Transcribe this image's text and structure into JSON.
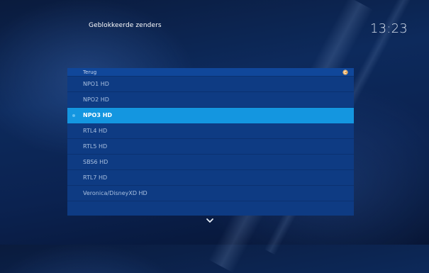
{
  "header": {
    "title": "Geblokkeerde zenders",
    "time": "13:23"
  },
  "list": {
    "back_label": "Terug",
    "items": [
      {
        "label": "NPO1 HD",
        "selected": false
      },
      {
        "label": "NPO2 HD",
        "selected": false
      },
      {
        "label": "NPO3 HD",
        "selected": true
      },
      {
        "label": "RTL4 HD",
        "selected": false
      },
      {
        "label": "RTL5 HD",
        "selected": false
      },
      {
        "label": "SBS6 HD",
        "selected": false
      },
      {
        "label": "RTL7 HD",
        "selected": false
      },
      {
        "label": "Veronica/DisneyXD HD",
        "selected": false
      }
    ]
  },
  "colors": {
    "background": "#0b2250",
    "list_background": "#0e3b83",
    "selected": "#1496e0",
    "back_row": "#10479a"
  },
  "icons": {
    "back": "back-icon",
    "scroll_down": "chevron-down-icon"
  }
}
